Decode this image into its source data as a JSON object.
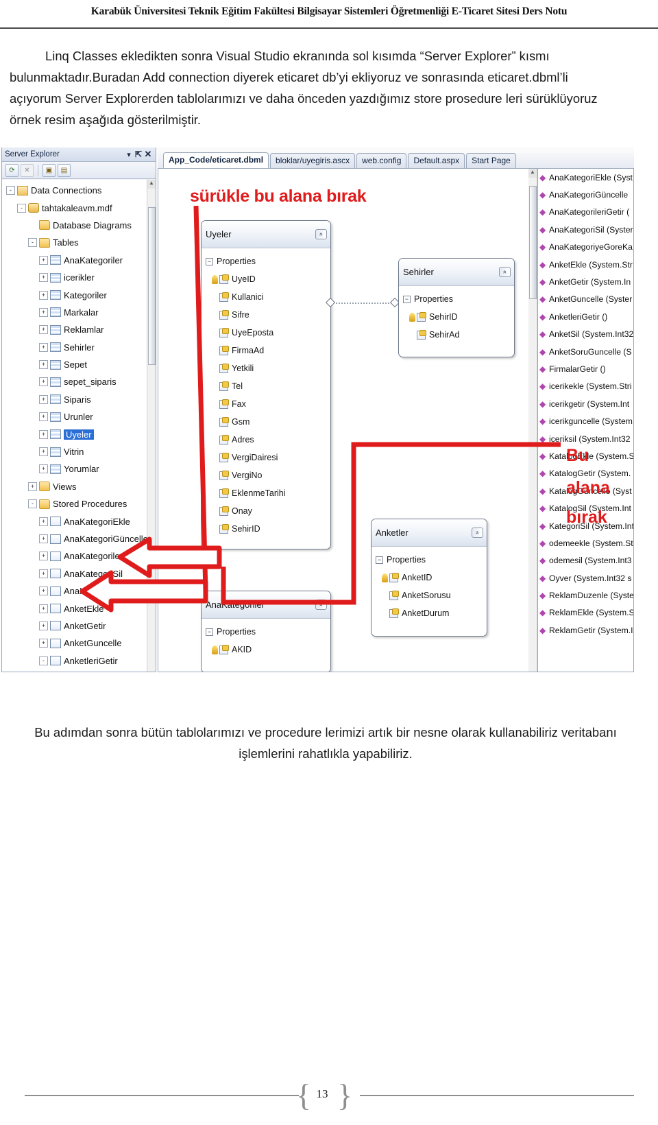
{
  "header": {
    "title": "Karabük Üniversitesi Teknik Eğitim Fakültesi Bilgisayar Sistemleri Öğretmenliği E-Ticaret Sitesi Ders Notu"
  },
  "paragraphs": {
    "intro": "Linq Classes ekledikten sonra Visual Studio ekranında sol kısımda “Server Explorer” kısmı bulunmaktadır.Buradan Add connection diyerek eticaret db’yi ekliyoruz ve sonrasında  eticaret.dbml’li açıyorum Server Explorerden tablolarımızı ve daha önceden yazdığımız store prosedure leri sürüklüyoruz örnek resim aşağıda gösterilmiştir.",
    "outro": "Bu adımdan sonra bütün tablolarımızı ve procedure lerimizi artık bir nesne olarak kullanabiliriz veritabanı işlemlerini rahatlıkla yapabiliriz."
  },
  "screenshot": {
    "server_explorer": {
      "title": "Server Explorer",
      "titlebar_icons": [
        "chevron-down-icon",
        "pin-icon",
        "close-icon"
      ],
      "toolbar_buttons": [
        "refresh-icon",
        "stop-icon",
        "connect-to-server-icon",
        "add-connection-icon"
      ],
      "tree": [
        {
          "label": "Data Connections",
          "indent": 0,
          "expander": "-",
          "icon": "folder-open",
          "selected": false
        },
        {
          "label": "tahtakaleavm.mdf",
          "indent": 1,
          "expander": "-",
          "icon": "db",
          "selected": false
        },
        {
          "label": "Database Diagrams",
          "indent": 2,
          "expander": "",
          "icon": "folder",
          "selected": false
        },
        {
          "label": "Tables",
          "indent": 2,
          "expander": "-",
          "icon": "folder",
          "selected": false
        },
        {
          "label": "AnaKategoriler",
          "indent": 3,
          "expander": "+",
          "icon": "table",
          "selected": false
        },
        {
          "label": "icerikler",
          "indent": 3,
          "expander": "+",
          "icon": "table",
          "selected": false
        },
        {
          "label": "Kategoriler",
          "indent": 3,
          "expander": "+",
          "icon": "table",
          "selected": false
        },
        {
          "label": "Markalar",
          "indent": 3,
          "expander": "+",
          "icon": "table",
          "selected": false
        },
        {
          "label": "Reklamlar",
          "indent": 3,
          "expander": "+",
          "icon": "table",
          "selected": false
        },
        {
          "label": "Sehirler",
          "indent": 3,
          "expander": "+",
          "icon": "table",
          "selected": false
        },
        {
          "label": "Sepet",
          "indent": 3,
          "expander": "+",
          "icon": "table",
          "selected": false
        },
        {
          "label": "sepet_siparis",
          "indent": 3,
          "expander": "+",
          "icon": "table",
          "selected": false
        },
        {
          "label": "Siparis",
          "indent": 3,
          "expander": "+",
          "icon": "table",
          "selected": false
        },
        {
          "label": "Urunler",
          "indent": 3,
          "expander": "+",
          "icon": "table",
          "selected": false
        },
        {
          "label": "Uyeler",
          "indent": 3,
          "expander": "+",
          "icon": "table",
          "selected": true
        },
        {
          "label": "Vitrin",
          "indent": 3,
          "expander": "+",
          "icon": "table",
          "selected": false
        },
        {
          "label": "Yorumlar",
          "indent": 3,
          "expander": "+",
          "icon": "table",
          "selected": false
        },
        {
          "label": "Views",
          "indent": 2,
          "expander": "+",
          "icon": "folder",
          "selected": false
        },
        {
          "label": "Stored Procedures",
          "indent": 2,
          "expander": "-",
          "icon": "folder",
          "selected": false
        },
        {
          "label": "AnaKategoriEkle",
          "indent": 3,
          "expander": "+",
          "icon": "proc",
          "selected": false
        },
        {
          "label": "AnaKategoriGüncelle",
          "indent": 3,
          "expander": "+",
          "icon": "proc",
          "selected": false
        },
        {
          "label": "AnaKategorileriGetir",
          "indent": 3,
          "expander": "+",
          "icon": "proc",
          "selected": false
        },
        {
          "label": "AnaKategoriSil",
          "indent": 3,
          "expander": "+",
          "icon": "proc",
          "selected": false
        },
        {
          "label": "AnaKategoriyeGoreKateg",
          "indent": 3,
          "expander": "+",
          "icon": "proc",
          "selected": false
        },
        {
          "label": "AnketEkle",
          "indent": 3,
          "expander": "+",
          "icon": "proc",
          "selected": false
        },
        {
          "label": "AnketGetir",
          "indent": 3,
          "expander": "+",
          "icon": "proc",
          "selected": false
        },
        {
          "label": "AnketGuncelle",
          "indent": 3,
          "expander": "+",
          "icon": "proc",
          "selected": false
        },
        {
          "label": "AnketleriGetir",
          "indent": 3,
          "expander": "-",
          "icon": "proc",
          "selected": false
        }
      ]
    },
    "editor_tabs": [
      {
        "label": "App_Code/eticaret.dbml",
        "active": true
      },
      {
        "label": "bloklar/uyegiris.ascx",
        "active": false
      },
      {
        "label": "web.config",
        "active": false
      },
      {
        "label": "Default.aspx",
        "active": false
      },
      {
        "label": "Start Page",
        "active": false
      }
    ],
    "entities": [
      {
        "name": "Uyeler",
        "group": "Properties",
        "properties": [
          {
            "label": "UyeID",
            "key": true
          },
          {
            "label": "Kullanici",
            "key": false
          },
          {
            "label": "Sifre",
            "key": false
          },
          {
            "label": "UyeEposta",
            "key": false
          },
          {
            "label": "FirmaAd",
            "key": false
          },
          {
            "label": "Yetkili",
            "key": false
          },
          {
            "label": "Tel",
            "key": false
          },
          {
            "label": "Fax",
            "key": false
          },
          {
            "label": "Gsm",
            "key": false
          },
          {
            "label": "Adres",
            "key": false
          },
          {
            "label": "VergiDairesi",
            "key": false
          },
          {
            "label": "VergiNo",
            "key": false
          },
          {
            "label": "EklenmeTarihi",
            "key": false
          },
          {
            "label": "Onay",
            "key": false
          },
          {
            "label": "SehirID",
            "key": false
          }
        ]
      },
      {
        "name": "Sehirler",
        "group": "Properties",
        "properties": [
          {
            "label": "SehirID",
            "key": true
          },
          {
            "label": "SehirAd",
            "key": false
          }
        ]
      },
      {
        "name": "Anketler",
        "group": "Properties",
        "properties": [
          {
            "label": "AnketID",
            "key": true
          },
          {
            "label": "AnketSorusu",
            "key": false
          },
          {
            "label": "AnketDurum",
            "key": false
          }
        ]
      },
      {
        "name": "AnaKategoriler",
        "group": "Properties",
        "properties": [
          {
            "label": "AKID",
            "key": true
          }
        ]
      }
    ],
    "methods_pane": [
      "AnaKategoriEkle (Syst",
      "AnaKategoriGüncelle",
      "AnaKategorileriGetir (",
      "AnaKategoriSil (Syster",
      "AnaKategoriyeGoreKa",
      "AnketEkle (System.Str",
      "AnketGetir (System.In",
      "AnketGuncelle (Syster",
      "AnketleriGetir ()",
      "AnketSil (System.Int32",
      "AnketSoruGuncelle (S",
      "FirmalarGetir ()",
      "icerikekle (System.Stri",
      "icerikgetir (System.Int",
      "icerikguncelle (System",
      "iceriksil (System.Int32",
      "KatalogEkle (System.S",
      "KatalogGetir (System.",
      "KatalogGuncelle (Syst",
      "KatalogSil (System.Int",
      "KategoriSil (System.Int",
      "odemeekle (System.St",
      "odemesil (System.Int3",
      "Oyver (System.Int32 s",
      "ReklamDuzenle (Syste",
      "ReklamEkle (System.S",
      "ReklamGetir (System.I"
    ],
    "annotations": {
      "drag_here": "sürükle bu alana bırak",
      "drop_line1": "Bu",
      "drop_line2": "alana",
      "drop_line3": "bırak",
      "color": "#e01b1b"
    }
  },
  "footer": {
    "page_number": "13",
    "brace_left": "{",
    "brace_right": "}"
  }
}
